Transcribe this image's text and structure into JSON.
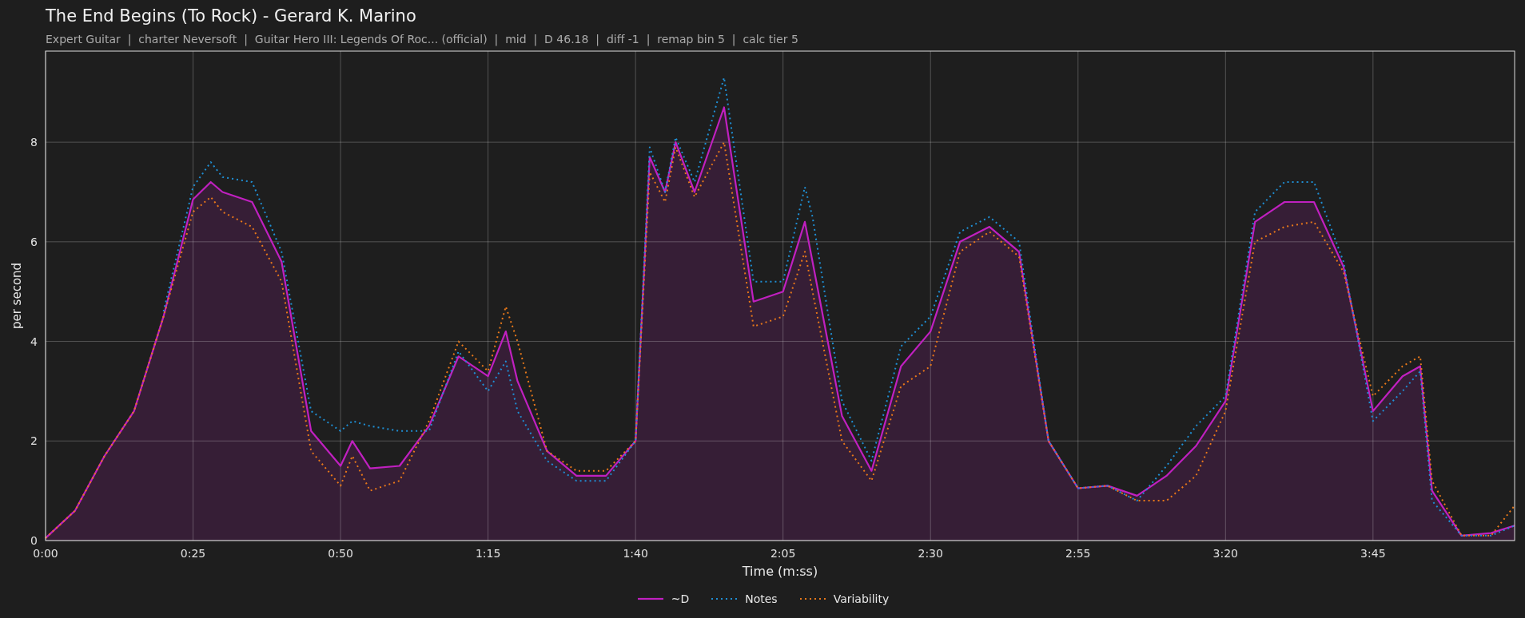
{
  "title": "The End Begins (To Rock) - Gerard K. Marino",
  "subtitle": "Expert Guitar  |  charter Neversoft  |  Guitar Hero III: Legends Of Roc... (official)  |  mid  |  D 46.18  |  diff -1  |  remap bin 5  |  calc tier 5",
  "chart": {
    "chart_data": {
      "type": "line",
      "grid": true,
      "xlabel": "Time (m:ss)",
      "ylabel": "per second",
      "x": [
        0,
        5,
        10,
        15,
        20,
        25,
        28,
        30,
        35,
        40,
        45,
        50,
        52,
        55,
        60,
        65,
        70,
        75,
        78,
        80,
        85,
        90,
        95,
        100,
        102.4,
        105,
        106.8,
        110,
        115,
        120,
        125,
        128.7,
        130,
        135,
        140,
        145,
        150,
        155,
        160,
        165,
        170,
        175,
        180,
        185,
        190,
        195,
        200,
        205,
        210,
        215,
        220,
        225,
        230,
        233,
        235,
        240,
        245,
        249
      ],
      "series": [
        {
          "name": "~D",
          "color": "#c020c0",
          "type": "area",
          "line_style": "solid",
          "values": [
            0.05,
            0.6,
            1.7,
            2.6,
            4.5,
            6.85,
            7.2,
            7.0,
            6.8,
            5.6,
            2.2,
            1.5,
            2.0,
            1.45,
            1.5,
            2.3,
            3.7,
            3.3,
            4.2,
            3.2,
            1.8,
            1.3,
            1.3,
            2.0,
            7.7,
            7.0,
            8.0,
            7.0,
            8.7,
            4.8,
            5.0,
            6.4,
            5.6,
            2.5,
            1.4,
            3.5,
            4.2,
            6.0,
            6.3,
            5.8,
            2.0,
            1.05,
            1.1,
            0.9,
            1.3,
            1.9,
            2.8,
            6.4,
            6.8,
            6.8,
            5.5,
            2.6,
            3.3,
            3.5,
            1.0,
            0.1,
            0.15,
            0.3
          ]
        },
        {
          "name": "Notes",
          "color": "#1f8fd4",
          "type": "line",
          "line_style": "dotted",
          "values": [
            null,
            null,
            null,
            null,
            4.6,
            7.1,
            7.6,
            7.3,
            7.2,
            5.8,
            2.6,
            2.2,
            2.4,
            2.3,
            2.2,
            2.2,
            3.8,
            3.0,
            3.6,
            2.6,
            1.6,
            1.2,
            1.2,
            2.0,
            7.9,
            7.0,
            8.1,
            7.2,
            9.3,
            5.2,
            5.2,
            7.1,
            6.5,
            2.8,
            1.6,
            3.9,
            4.5,
            6.2,
            6.5,
            6.0,
            2.0,
            1.05,
            1.1,
            0.8,
            1.5,
            2.3,
            2.9,
            6.6,
            7.2,
            7.2,
            5.6,
            2.4,
            3.0,
            3.4,
            0.8,
            0.1,
            0.1,
            0.3
          ]
        },
        {
          "name": "Variability",
          "color": "#e8781a",
          "type": "line",
          "line_style": "dotted",
          "values": [
            0.05,
            0.6,
            1.7,
            2.6,
            4.5,
            6.6,
            6.9,
            6.6,
            6.3,
            5.2,
            1.8,
            1.1,
            1.7,
            1.0,
            1.2,
            2.4,
            4.0,
            3.4,
            4.7,
            4.0,
            1.8,
            1.4,
            1.4,
            2.0,
            7.4,
            6.8,
            7.9,
            6.9,
            8.0,
            4.3,
            4.5,
            5.8,
            5.0,
            2.0,
            1.2,
            3.1,
            3.5,
            5.8,
            6.2,
            5.7,
            2.0,
            1.05,
            1.1,
            0.8,
            0.8,
            1.3,
            2.6,
            6.0,
            6.3,
            6.4,
            5.4,
            2.9,
            3.5,
            3.7,
            1.2,
            0.1,
            0.1,
            0.7
          ]
        }
      ],
      "xlim": [
        0,
        249
      ],
      "ylim": [
        0,
        9.83
      ],
      "xticks": [
        {
          "value": 0,
          "label": "0:00"
        },
        {
          "value": 25,
          "label": "0:25"
        },
        {
          "value": 50,
          "label": "0:50"
        },
        {
          "value": 75,
          "label": "1:15"
        },
        {
          "value": 100,
          "label": "1:40"
        },
        {
          "value": 125,
          "label": "2:05"
        },
        {
          "value": 150,
          "label": "2:30"
        },
        {
          "value": 175,
          "label": "2:55"
        },
        {
          "value": 200,
          "label": "3:20"
        },
        {
          "value": 225,
          "label": "3:45"
        }
      ],
      "yticks": [
        0,
        2,
        4,
        6,
        8
      ]
    }
  }
}
